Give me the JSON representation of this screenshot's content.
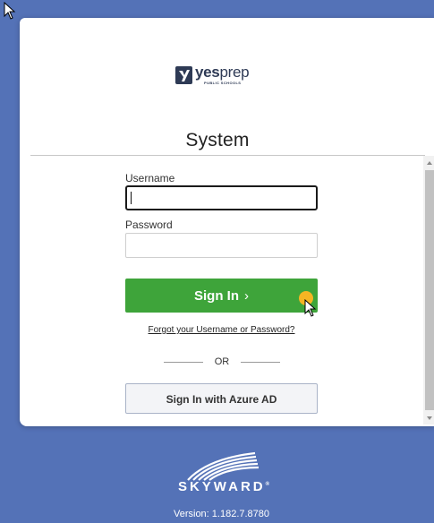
{
  "brand": {
    "name_bold": "yes",
    "name_thin": "prep",
    "subtitle": "PUBLIC SCHOOLS"
  },
  "login": {
    "title": "System",
    "username_label": "Username",
    "username_value": "",
    "password_label": "Password",
    "password_value": "",
    "signin_label": "Sign In",
    "signin_chevron": "›",
    "forgot_link": "Forgot your Username or Password?",
    "or_text": "OR",
    "azure_label": "Sign In with Azure AD"
  },
  "footer": {
    "logo_text": "SKYWARD",
    "logo_mark": "®",
    "version": "Version: 1.182.7.8780"
  },
  "colors": {
    "background": "#5472b7",
    "signin_button": "#3ea43a",
    "click_indicator": "#f5b523"
  }
}
